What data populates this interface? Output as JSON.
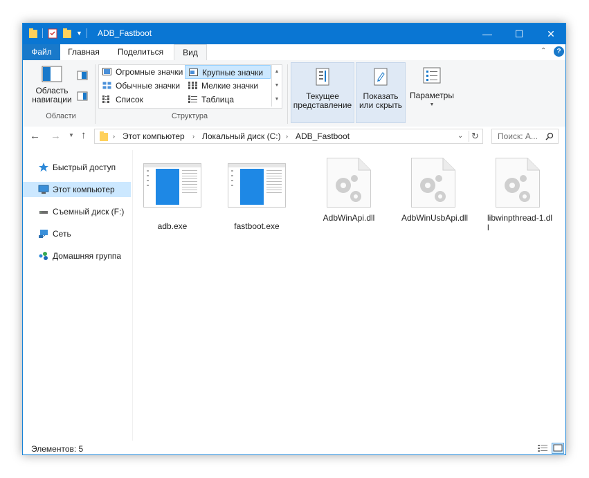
{
  "window": {
    "title": "ADB_Fastboot",
    "controls": {
      "minimize": "—",
      "maximize": "☐",
      "close": "✕"
    }
  },
  "ribbon_tabs": [
    "Файл",
    "Главная",
    "Поделиться",
    "Вид"
  ],
  "ribbon": {
    "panes": {
      "nav_pane_label": "Область навигации",
      "group_label": "Области"
    },
    "layout": {
      "items": [
        "Огромные значки",
        "Крупные значки",
        "Обычные значки",
        "Мелкие значки",
        "Список",
        "Таблица"
      ],
      "selected": "Крупные значки",
      "group_label": "Структура"
    },
    "current_view": "Текущее представление",
    "show_hide": "Показать или скрыть",
    "options": "Параметры"
  },
  "address": {
    "crumbs": [
      "Этот компьютер",
      "Локальный диск (C:)",
      "ADB_Fastboot"
    ],
    "search_placeholder": "Поиск: A..."
  },
  "nav_pane": {
    "items": [
      {
        "label": "Быстрый доступ",
        "icon": "star-icon"
      },
      {
        "label": "Этот компьютер",
        "icon": "computer-icon",
        "selected": true
      },
      {
        "label": "Съемный диск (F:)",
        "icon": "drive-icon"
      },
      {
        "label": "Сеть",
        "icon": "network-icon"
      },
      {
        "label": "Домашняя группа",
        "icon": "homegroup-icon"
      }
    ]
  },
  "files": [
    {
      "name": "adb.exe",
      "kind": "exe"
    },
    {
      "name": "fastboot.exe",
      "kind": "exe"
    },
    {
      "name": "AdbWinApi.dll",
      "kind": "dll"
    },
    {
      "name": "AdbWinUsbApi.dll",
      "kind": "dll"
    },
    {
      "name": "libwinpthread-1.dll",
      "kind": "dll"
    }
  ],
  "status": {
    "items_count": "Элементов: 5"
  },
  "colors": {
    "titlebar": "#0a76d3",
    "selection": "#cce8ff",
    "file_tab": "#1979ca"
  }
}
